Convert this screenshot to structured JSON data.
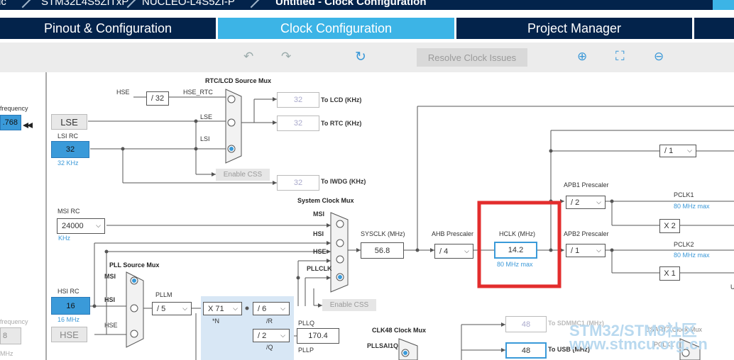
{
  "breadcrumb": {
    "items": [
      "ic",
      "STM32L4S5ZITxP",
      "NUCLEO-L4S5ZI-P",
      "Untitled - Clock Configuration"
    ]
  },
  "tabs": [
    {
      "label": "Pinout & Configuration",
      "active": false
    },
    {
      "label": "Clock Configuration",
      "active": true
    },
    {
      "label": "Project Manager",
      "active": false
    }
  ],
  "toolbar": {
    "undo_icon": "undo-icon",
    "redo_icon": "redo-icon",
    "refresh_icon": "refresh-icon",
    "resolve_label": "Resolve Clock Issues",
    "zoom_in_icon": "zoom-in-icon",
    "fit_icon": "fit-icon",
    "zoom_out_icon": "zoom-out-icon"
  },
  "diagram": {
    "lse_input_label": "frequency",
    "lse_value": ".768",
    "lse_label": "LSE",
    "lsi_rc_label": "LSI RC",
    "lsi_value": "32",
    "lsi_note": "32 KHz",
    "rtc_mux_title": "RTC/LCD Source Mux",
    "hse_label": "HSE",
    "hse_div": "/ 32",
    "hse_rtc_label": "HSE_RTC",
    "lse_mux_label": "LSE",
    "lsi_mux_label": "LSI",
    "lcd_value": "32",
    "lcd_label": "To LCD (KHz)",
    "rtc_value": "32",
    "rtc_label": "To RTC (KHz)",
    "enable_css_1": "Enable CSS",
    "iwdg_value": "32",
    "iwdg_label": "To IWDG (KHz)",
    "msi_rc_label": "MSI RC",
    "msi_value": "24000",
    "msi_note": "KHz",
    "sys_mux_title": "System Clock Mux",
    "sys_msi": "MSI",
    "sys_hsi": "HSI",
    "sys_hse": "HSE",
    "sys_pllclk": "PLLCLK",
    "sysclk_label": "SYSCLK (MHz)",
    "sysclk_value": "56.8",
    "ahb_label": "AHB Prescaler",
    "ahb_value": "/ 4",
    "hclk_label": "HCLK (MHz)",
    "hclk_value": "14.2",
    "hclk_note": "80 MHz max",
    "enable_css_2": "Enable CSS",
    "apb_top_value": "/ 1",
    "apb1_label": "APB1 Prescaler",
    "apb1_value": "/ 2",
    "pclk1_label": "PCLK1",
    "pclk1_note": "80 MHz max",
    "x2_label": "X 2",
    "apb2_label": "APB2 Prescaler",
    "apb2_value": "/ 1",
    "pclk2_label": "PCLK2",
    "pclk2_note": "80 MHz max",
    "x1_label": "X 1",
    "pll_src_title": "PLL Source Mux",
    "pll_msi": "MSI",
    "pll_hsi": "HSI",
    "pll_hse": "HSE",
    "hsi_rc_label": "HSI RC",
    "hsi_value": "16",
    "hsi_note": "16 MHz",
    "hse_freq_label": "frequency",
    "hse_freq_value": "8",
    "hse_box_label": "HSE",
    "hse_mhz_note": "MHz",
    "pllm_label": "PLLM",
    "pllm_value": "/ 5",
    "pll_n_value": "X 71",
    "pll_n_label": "*N",
    "pll_r_value": "/ 6",
    "pll_r_label": "/R",
    "pll_q_value": "/ 2",
    "pll_q_label": "/Q",
    "pllq_label": "PLLQ",
    "pllq_value": "170.4",
    "pllp_label": "PLLP",
    "clk48_title": "CLK48 Clock Mux",
    "pllsai1q_label": "PLLSAI1Q",
    "sdmmc_value": "48",
    "sdmmc_label": "To SDMMC1 (MHz)",
    "usb_value": "48",
    "usb_label": "To USB (MHz)",
    "usart2_label": "USART2 Clock Mux",
    "pclk1_mux_label": "PCLK1",
    "u_label": "U"
  },
  "watermark": {
    "line1": "STM32/STM8社区",
    "line2": "www.stmcu.org.cn"
  },
  "colors": {
    "navy": "#03234b",
    "accent": "#3cb4e6",
    "box_blue": "#3a9ad9",
    "highlight_red": "#e32d2d"
  }
}
